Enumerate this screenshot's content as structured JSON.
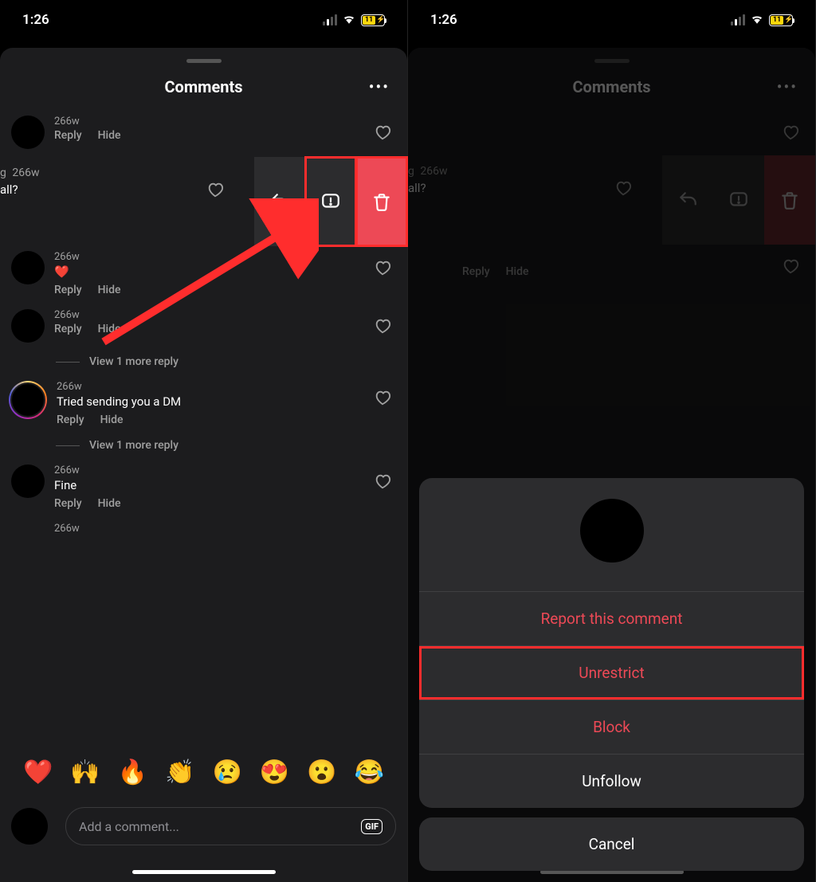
{
  "status": {
    "time": "1:26",
    "battery": "11"
  },
  "header": {
    "title": "Comments"
  },
  "labels": {
    "reply": "Reply",
    "hide": "Hide",
    "viewMore": "View 1 more reply"
  },
  "comments": {
    "c1": {
      "time": "266w"
    },
    "c2": {
      "label": "g",
      "time": "266w",
      "text": "all?"
    },
    "c3": {
      "time": "266w",
      "emoji": "❤️"
    },
    "c4": {
      "time": "266w"
    },
    "c5": {
      "time": "266w",
      "text": "Tried sending you a DM"
    },
    "c6": {
      "time": "266w",
      "text": "Fine"
    },
    "c7": {
      "time": "266w"
    }
  },
  "emojis": [
    "❤️",
    "🙌",
    "🔥",
    "👏",
    "😢",
    "😍",
    "😮",
    "😂"
  ],
  "composer": {
    "placeholder": "Add a comment...",
    "gif": "GIF"
  },
  "actionSheet": {
    "report": "Report this comment",
    "unrestrict": "Unrestrict",
    "block": "Block",
    "unfollow": "Unfollow",
    "cancel": "Cancel"
  }
}
